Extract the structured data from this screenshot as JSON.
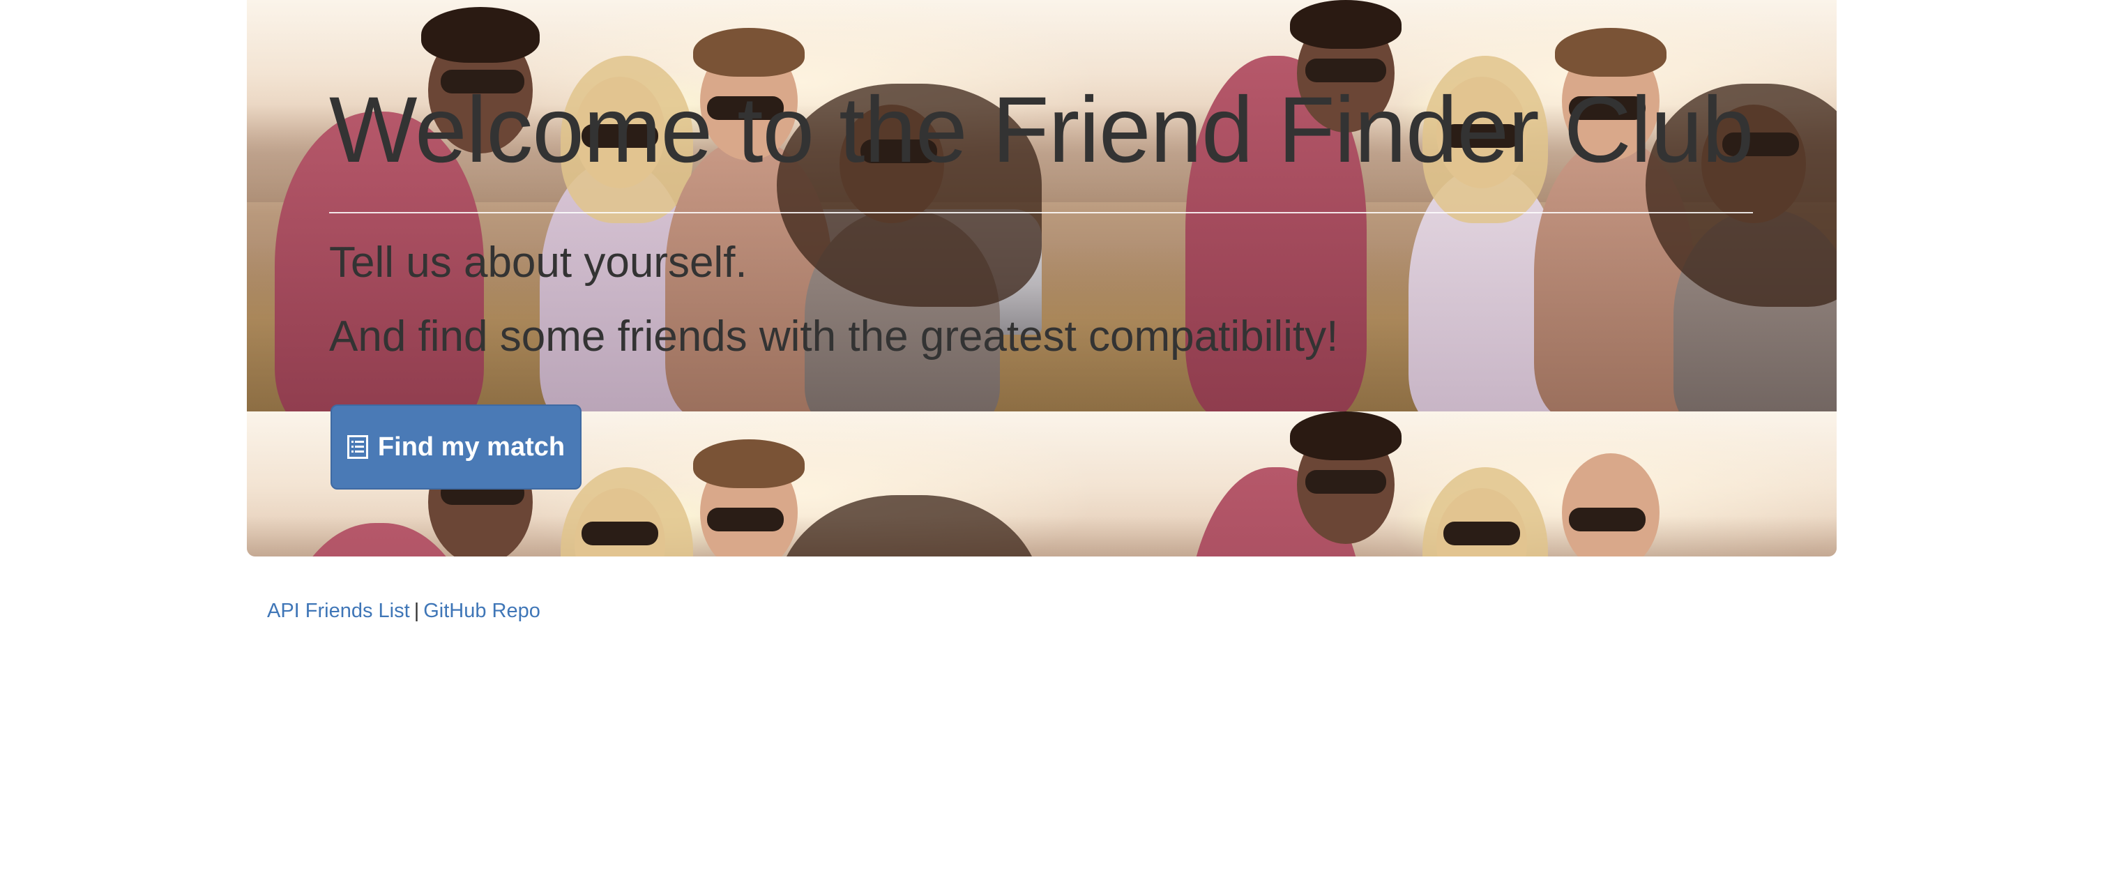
{
  "hero": {
    "title": "Welcome to the Friend Finder Club",
    "subtitle_1": "Tell us about yourself.",
    "subtitle_2": "And find some friends with the greatest compatibility!",
    "button_label": "Find my match",
    "button_icon": "list-alt-icon",
    "background_image": "group-of-friends-photo"
  },
  "footer": {
    "link_api": "API Friends List",
    "separator": "|",
    "link_github": "GitHub Repo"
  },
  "colors": {
    "primary_button": "#4a7ab6",
    "link": "#3f76b7",
    "text": "#333333"
  }
}
